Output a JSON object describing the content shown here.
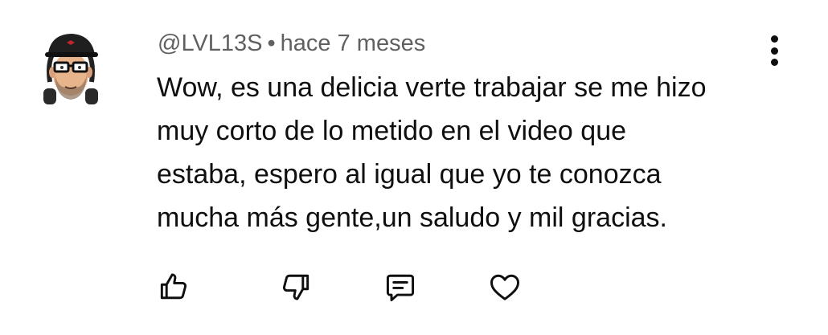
{
  "comment": {
    "author": "@LVL13S",
    "separator": "•",
    "time": "hace 7 meses",
    "lines": [
      "Wow, es una delicia verte trabajar se me hizo",
      "muy corto de lo metido en el video que",
      "estaba, espero al igual que yo te conozca",
      "mucha más gente,un saludo y mil gracias."
    ]
  },
  "icons": {
    "menu": "more-vert-icon",
    "like": "thumb-up-icon",
    "dislike": "thumb-down-icon",
    "reply": "reply-comment-icon",
    "heart": "heart-icon"
  },
  "colors": {
    "text": "#0f0f0f",
    "meta": "#606060",
    "background": "#ffffff"
  }
}
